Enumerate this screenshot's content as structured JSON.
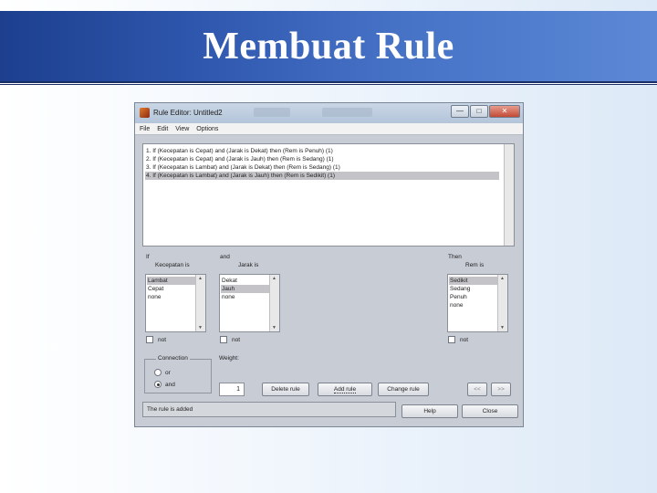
{
  "slide": {
    "title": "Membuat Rule"
  },
  "window": {
    "title": "Rule Editor: Untitled2",
    "controls": {
      "minimize": "—",
      "maximize": "□",
      "close": "✕"
    }
  },
  "menu": [
    "File",
    "Edit",
    "View",
    "Options"
  ],
  "rules": [
    "1. If (Kecepatan is Cepat) and (Jarak is Dekat) then (Rem is Penuh) (1)",
    "2. If (Kecepatan is Cepat) and (Jarak is Jauh) then (Rem is Sedang) (1)",
    "3. If (Kecepatan is Lambat) and (Jarak is Dekat) then (Rem is Sedang) (1)",
    "4. If (Kecepatan is Lambat) and (Jarak is Jauh) then (Rem is Sedikit) (1)"
  ],
  "selected_rule_index": 3,
  "if_section": {
    "keyword": "If",
    "variable": "Kecepatan is",
    "options": [
      "Lambat",
      "Cepat",
      "none"
    ],
    "selected": "Lambat",
    "not_label": "not"
  },
  "and_section": {
    "keyword": "and",
    "variable": "Jarak is",
    "options": [
      "Dekat",
      "Jauh",
      "none"
    ],
    "selected": "Jauh",
    "not_label": "not"
  },
  "then_section": {
    "keyword": "Then",
    "variable": "Rem is",
    "options": [
      "Sedikit",
      "Sedang",
      "Penuh",
      "none"
    ],
    "selected": "Sedikit",
    "not_label": "not"
  },
  "connection": {
    "label": "Connection",
    "options": [
      "or",
      "and"
    ],
    "selected": "and"
  },
  "weight": {
    "label": "Weight:",
    "value": "1"
  },
  "buttons": {
    "delete_rule": "Delete rule",
    "add_rule": "Add rule",
    "change_rule": "Change rule",
    "prev": "<<",
    "next": ">>",
    "help": "Help",
    "close": "Close"
  },
  "status": "The rule is added"
}
